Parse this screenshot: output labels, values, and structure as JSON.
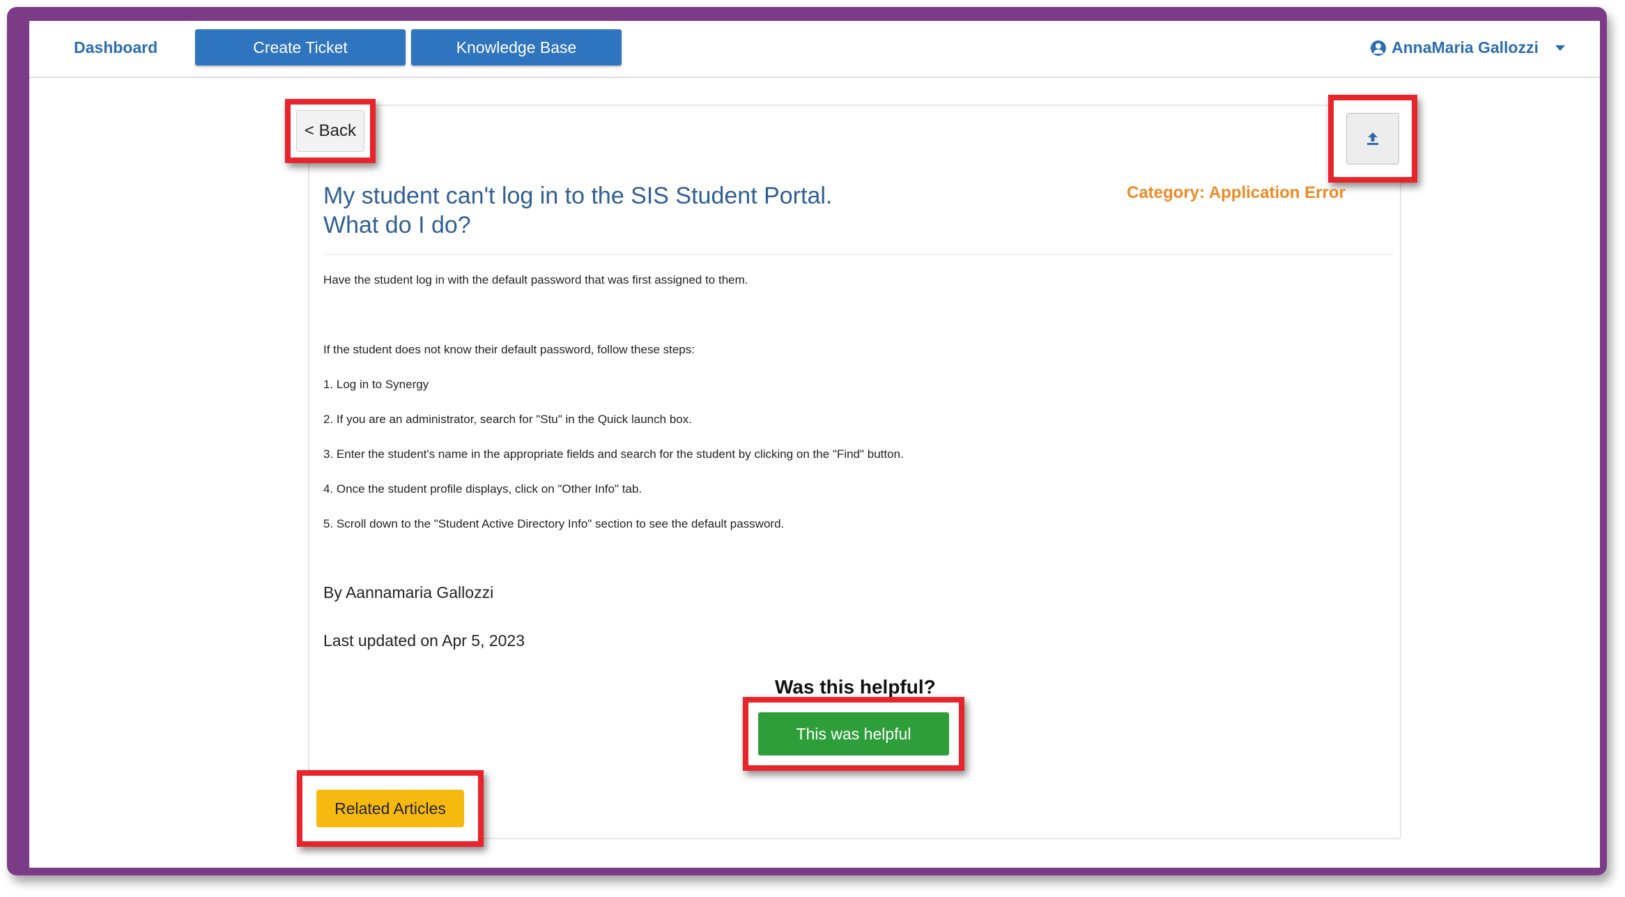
{
  "nav": {
    "dashboard": "Dashboard",
    "create_ticket": "Create Ticket",
    "knowledge_base": "Knowledge Base",
    "user_name": "AnnaMaria Gallozzi"
  },
  "article": {
    "back_label": "< Back",
    "title_line1": "My student can't log in to the SIS Student Portal.",
    "title_line2": "What do I do?",
    "category": "Category: Application Error",
    "intro": "Have the student log in with the default password that was first assigned to them.",
    "steps_intro": "If the student does not know their default password, follow these steps:",
    "steps": [
      "1. Log in to Synergy",
      "2. If you are an administrator, search for \"Stu\" in the Quick launch box.",
      "3. Enter the student's name in the appropriate fields and search for the student by clicking on the \"Find\" button.",
      "4. Once the student profile displays, click on \"Other Info\" tab.",
      "5. Scroll down to the \"Student Active Directory Info\" section to see the default password."
    ],
    "author": "By Aannamaria Gallozzi",
    "updated": "Last updated on Apr 5, 2023",
    "helpful_question": "Was this helpful?",
    "helpful_button": "This was helpful",
    "related_button": "Related Articles"
  },
  "colors": {
    "frame": "#7b3b86",
    "nav_button": "#2f74bf",
    "link": "#2a6db0",
    "title": "#2f5f94",
    "category": "#ee8a24",
    "helpful": "#2e9e3a",
    "related": "#f6b90f",
    "highlight": "#e8232a"
  },
  "icons": {
    "user": "user-circle-icon",
    "dropdown": "chevron-down-icon",
    "export": "upload-icon"
  }
}
